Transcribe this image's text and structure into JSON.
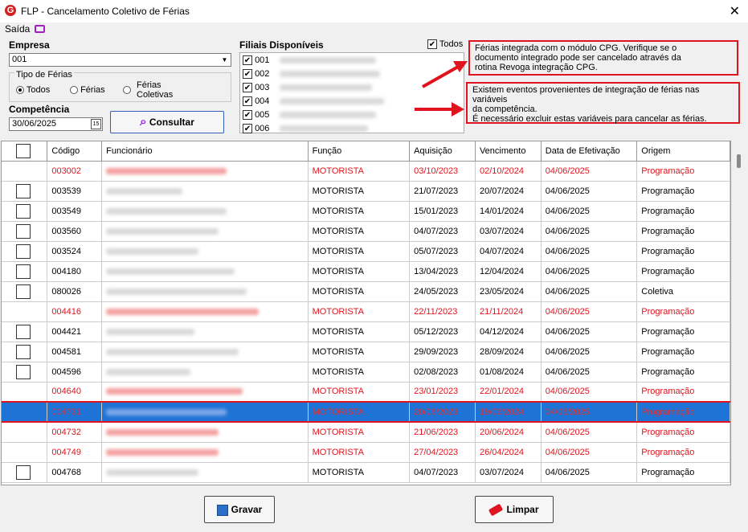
{
  "window": {
    "title": "FLP - Cancelamento Coletivo de Férias",
    "close": "✕"
  },
  "menu": {
    "saida": "Saída"
  },
  "empresa": {
    "label": "Empresa",
    "value": "001"
  },
  "tipo_ferias": {
    "legend": "Tipo de Férias",
    "options": [
      "Todos",
      "Férias",
      "Férias Coletivas"
    ],
    "selected": "Todos"
  },
  "competencia": {
    "label": "Competência",
    "value": "30/06/2025",
    "calendar_label": "15"
  },
  "consultar": {
    "label": "Consultar"
  },
  "filiais": {
    "label": "Filiais Disponíveis",
    "todos_label": "Todos",
    "items": [
      "001",
      "002",
      "003",
      "004",
      "005",
      "006"
    ]
  },
  "info": {
    "line1": "Férias integrada com o módulo CPG. Verifique se o",
    "line2": "documento integrado pode ser cancelado através da",
    "line3": "rotina Revoga integração CPG.",
    "line4": "Existem eventos provenientes de integração de férias nas variáveis",
    "line5": "da competência.",
    "line6": "É necessário excluir estas variáveis para cancelar as férias."
  },
  "table": {
    "headers": [
      "Código",
      "Funcionário",
      "Função",
      "Aquisição",
      "Vencimento",
      "Data de Efetivação",
      "Origem"
    ],
    "rows": [
      {
        "codigo": "003002",
        "funcao": "MOTORISTA",
        "aquisicao": "03/10/2023",
        "vencimento": "02/10/2024",
        "efetivacao": "04/06/2025",
        "origem": "Programação",
        "style": "red",
        "checkbox": false
      },
      {
        "codigo": "003539",
        "funcao": "MOTORISTA",
        "aquisicao": "21/07/2023",
        "vencimento": "20/07/2024",
        "efetivacao": "04/06/2025",
        "origem": "Programação",
        "style": "normal",
        "checkbox": true
      },
      {
        "codigo": "003549",
        "funcao": "MOTORISTA",
        "aquisicao": "15/01/2023",
        "vencimento": "14/01/2024",
        "efetivacao": "04/06/2025",
        "origem": "Programação",
        "style": "normal",
        "checkbox": true
      },
      {
        "codigo": "003560",
        "funcao": "MOTORISTA",
        "aquisicao": "04/07/2023",
        "vencimento": "03/07/2024",
        "efetivacao": "04/06/2025",
        "origem": "Programação",
        "style": "normal",
        "checkbox": true
      },
      {
        "codigo": "003524",
        "funcao": "MOTORISTA",
        "aquisicao": "05/07/2023",
        "vencimento": "04/07/2024",
        "efetivacao": "04/06/2025",
        "origem": "Programação",
        "style": "normal",
        "checkbox": true
      },
      {
        "codigo": "004180",
        "funcao": "MOTORISTA",
        "aquisicao": "13/04/2023",
        "vencimento": "12/04/2024",
        "efetivacao": "04/06/2025",
        "origem": "Programação",
        "style": "normal",
        "checkbox": true
      },
      {
        "codigo": "080026",
        "funcao": "MOTORISTA",
        "aquisicao": "24/05/2023",
        "vencimento": "23/05/2024",
        "efetivacao": "04/06/2025",
        "origem": "Coletiva",
        "style": "normal",
        "checkbox": true
      },
      {
        "codigo": "004416",
        "funcao": "MOTORISTA",
        "aquisicao": "22/11/2023",
        "vencimento": "21/11/2024",
        "efetivacao": "04/06/2025",
        "origem": "Programação",
        "style": "red",
        "checkbox": false
      },
      {
        "codigo": "004421",
        "funcao": "MOTORISTA",
        "aquisicao": "05/12/2023",
        "vencimento": "04/12/2024",
        "efetivacao": "04/06/2025",
        "origem": "Programação",
        "style": "normal",
        "checkbox": true
      },
      {
        "codigo": "004581",
        "funcao": "MOTORISTA",
        "aquisicao": "29/09/2023",
        "vencimento": "28/09/2024",
        "efetivacao": "04/06/2025",
        "origem": "Programação",
        "style": "normal",
        "checkbox": true
      },
      {
        "codigo": "004596",
        "funcao": "MOTORISTA",
        "aquisicao": "02/08/2023",
        "vencimento": "01/08/2024",
        "efetivacao": "04/06/2025",
        "origem": "Programação",
        "style": "normal",
        "checkbox": true
      },
      {
        "codigo": "004640",
        "funcao": "MOTORISTA",
        "aquisicao": "23/01/2023",
        "vencimento": "22/01/2024",
        "efetivacao": "04/06/2025",
        "origem": "Programação",
        "style": "red",
        "checkbox": false
      },
      {
        "codigo": "004731",
        "funcao": "MOTORISTA",
        "aquisicao": "20/06/2023",
        "vencimento": "19/06/2024",
        "efetivacao": "04/06/2025",
        "origem": "Programação",
        "style": "sel",
        "checkbox": false
      },
      {
        "codigo": "004732",
        "funcao": "MOTORISTA",
        "aquisicao": "21/06/2023",
        "vencimento": "20/06/2024",
        "efetivacao": "04/06/2025",
        "origem": "Programação",
        "style": "red",
        "checkbox": false
      },
      {
        "codigo": "004749",
        "funcao": "MOTORISTA",
        "aquisicao": "27/04/2023",
        "vencimento": "26/04/2024",
        "efetivacao": "04/06/2025",
        "origem": "Programação",
        "style": "red",
        "checkbox": false
      },
      {
        "codigo": "004768",
        "funcao": "MOTORISTA",
        "aquisicao": "04/07/2023",
        "vencimento": "03/07/2024",
        "efetivacao": "04/06/2025",
        "origem": "Programação",
        "style": "normal",
        "checkbox": true
      }
    ]
  },
  "buttons": {
    "gravar": "Gravar",
    "limpar": "Limpar"
  },
  "colors": {
    "selection": "#1e73d6",
    "alert_red": "#e0141e",
    "primary_border": "#2d5fb8"
  }
}
